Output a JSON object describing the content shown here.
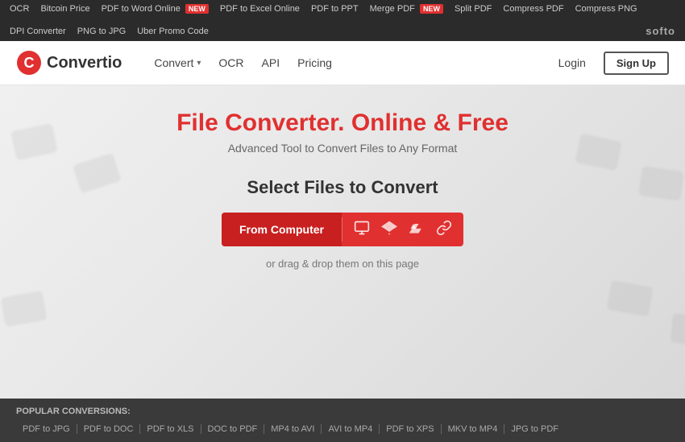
{
  "top_toolbar": {
    "links": [
      {
        "label": "OCR",
        "new": false
      },
      {
        "label": "Bitcoin Price",
        "new": false
      },
      {
        "label": "PDF to Word Online",
        "new": true
      },
      {
        "label": "PDF to Excel Online",
        "new": false
      },
      {
        "label": "PDF to PPT",
        "new": false
      },
      {
        "label": "Merge PDF",
        "new": true
      },
      {
        "label": "Split PDF",
        "new": false
      },
      {
        "label": "Compress PDF",
        "new": false
      },
      {
        "label": "Compress PNG",
        "new": false
      }
    ],
    "second_row_links": [
      {
        "label": "DPI Converter"
      },
      {
        "label": "PNG to JPG"
      },
      {
        "label": "Uber Promo Code"
      }
    ],
    "softo": "softo"
  },
  "header": {
    "logo_text": "Convertio",
    "nav_items": [
      {
        "label": "Convert",
        "has_dropdown": true
      },
      {
        "label": "OCR",
        "has_dropdown": false
      },
      {
        "label": "API",
        "has_dropdown": false
      },
      {
        "label": "Pricing",
        "has_dropdown": false
      }
    ],
    "login_label": "Login",
    "signup_label": "Sign Up"
  },
  "hero": {
    "title": "File Converter. Online & Free",
    "subtitle": "Advanced Tool to Convert Files to Any Format",
    "select_label": "Select Files to Convert",
    "from_computer": "From Computer",
    "drag_drop": "or drag & drop them on this page"
  },
  "footer": {
    "popular_label": "POPULAR CONVERSIONS:",
    "links": [
      "PDF to JPG",
      "PDF to DOC",
      "PDF to XLS",
      "DOC to PDF",
      "MP4 to AVI",
      "AVI to MP4",
      "PDF to XPS",
      "MKV to MP4",
      "JPG to PDF"
    ]
  }
}
